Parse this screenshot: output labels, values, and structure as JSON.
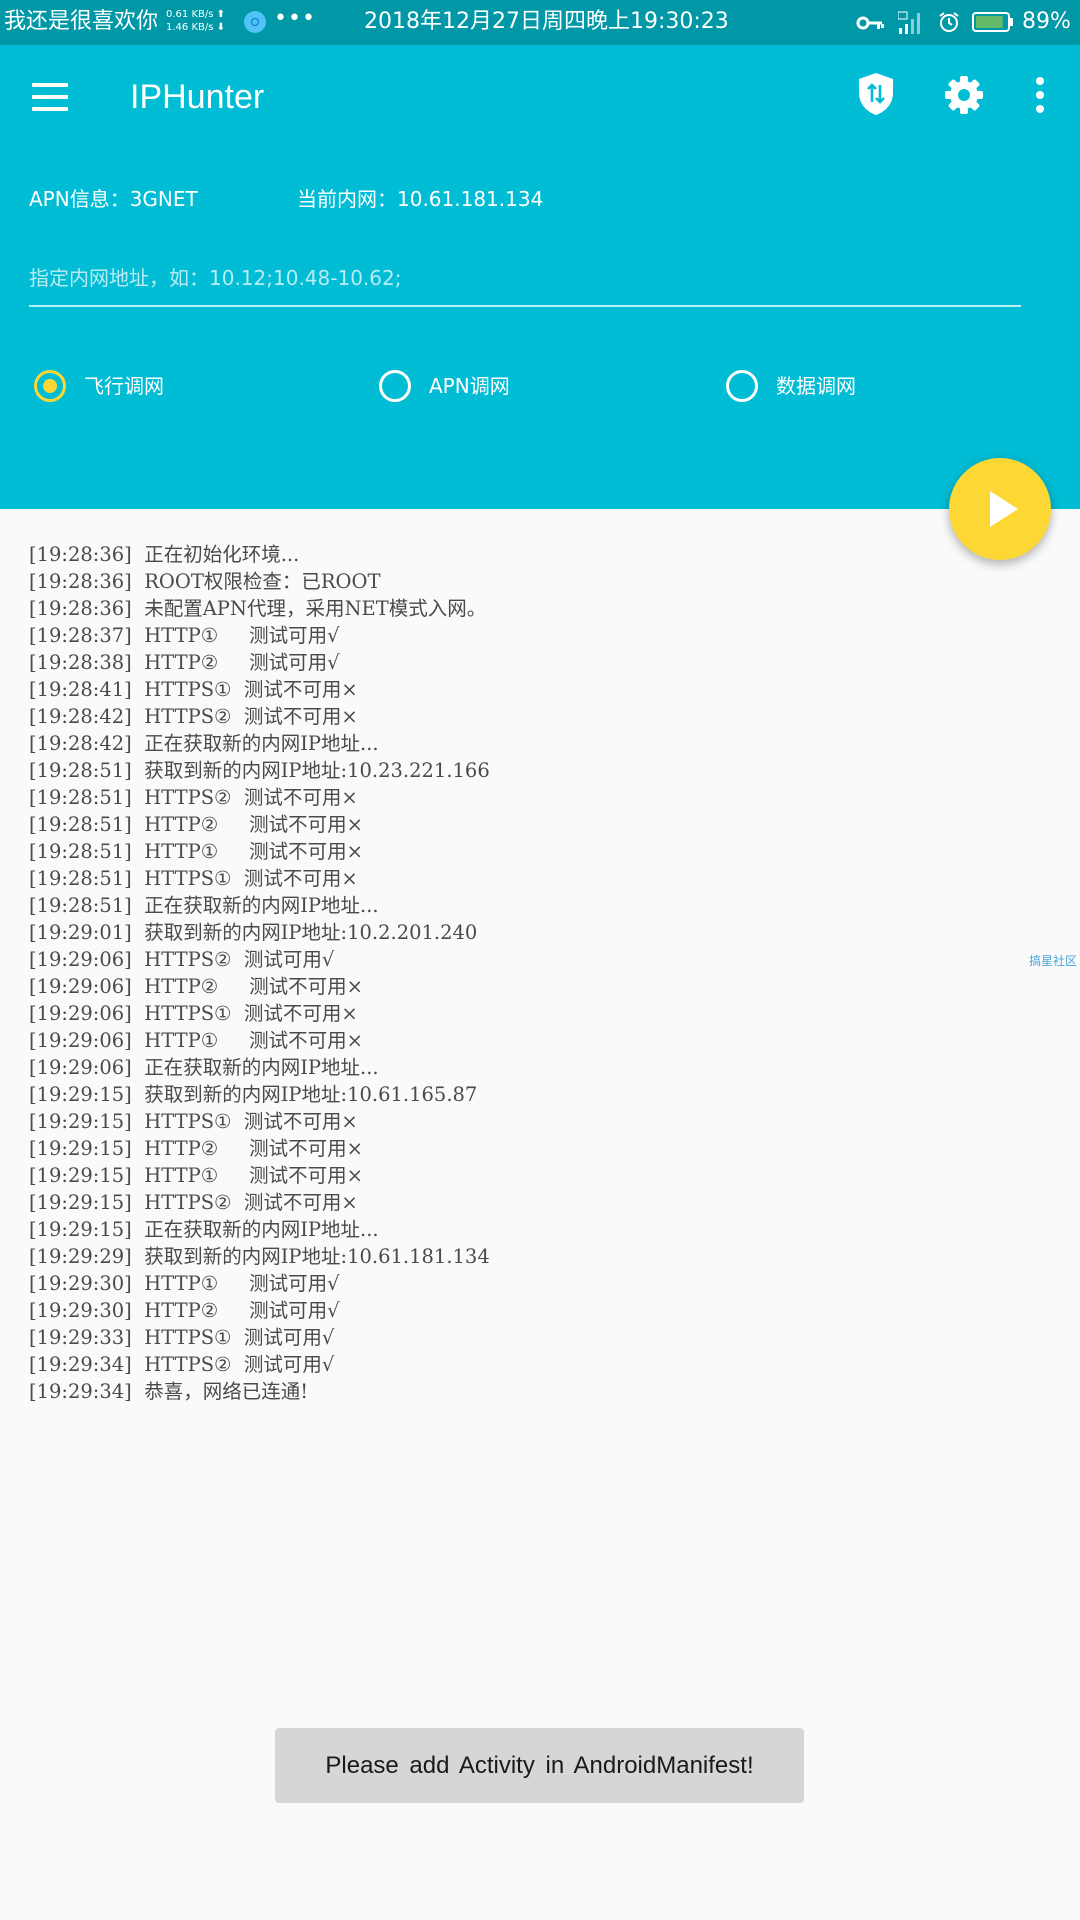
{
  "status_bar": {
    "carrier": "我还是很喜欢你",
    "speed_up": "0.61 KB/s",
    "speed_down": "1.46 KB/s",
    "more": "•••",
    "datetime": "2018年12月27日周四晚上19:30:23",
    "battery_percent": "89%",
    "battery_level": 0.89,
    "icons": [
      "search-icon",
      "key-icon",
      "signal-icon",
      "alarm-icon",
      "battery-icon"
    ]
  },
  "toolbar": {
    "title": "IPHunter",
    "icons": [
      "menu-icon",
      "shield-icon",
      "gear-icon",
      "more-vert-icon"
    ]
  },
  "info": {
    "apn": "APN信息：3GNET",
    "intranet": "当前内网：10.61.181.134"
  },
  "input": {
    "placeholder": "指定内网地址，如：10.12;10.48-10.62;",
    "value": ""
  },
  "modes": [
    {
      "label": "飞行调网",
      "checked": true
    },
    {
      "label": "APN调网",
      "checked": false
    },
    {
      "label": "数据调网",
      "checked": false
    }
  ],
  "fab": {
    "icon": "play-icon"
  },
  "log": [
    "[19:28:36]  正在初始化环境...",
    "[19:28:36]  ROOT权限检查：已ROOT",
    "[19:28:36]  未配置APN代理，采用NET模式入网。",
    "[19:28:37]  HTTP①     测试可用√",
    "[19:28:38]  HTTP②     测试可用√",
    "[19:28:41]  HTTPS①  测试不可用×",
    "[19:28:42]  HTTPS②  测试不可用×",
    "[19:28:42]  正在获取新的内网IP地址...",
    "[19:28:51]  获取到新的内网IP地址:10.23.221.166",
    "[19:28:51]  HTTPS②  测试不可用×",
    "[19:28:51]  HTTP②     测试不可用×",
    "[19:28:51]  HTTP①     测试不可用×",
    "[19:28:51]  HTTPS①  测试不可用×",
    "[19:28:51]  正在获取新的内网IP地址...",
    "[19:29:01]  获取到新的内网IP地址:10.2.201.240",
    "[19:29:06]  HTTPS②  测试可用√",
    "[19:29:06]  HTTP②     测试不可用×",
    "[19:29:06]  HTTPS①  测试不可用×",
    "[19:29:06]  HTTP①     测试不可用×",
    "[19:29:06]  正在获取新的内网IP地址...",
    "[19:29:15]  获取到新的内网IP地址:10.61.165.87",
    "[19:29:15]  HTTPS①  测试不可用×",
    "[19:29:15]  HTTP②     测试不可用×",
    "[19:29:15]  HTTP①     测试不可用×",
    "[19:29:15]  HTTPS②  测试不可用×",
    "[19:29:15]  正在获取新的内网IP地址...",
    "[19:29:29]  获取到新的内网IP地址:10.61.181.134",
    "[19:29:30]  HTTP①     测试可用√",
    "[19:29:30]  HTTP②     测试可用√",
    "[19:29:33]  HTTPS①  测试可用√",
    "[19:29:34]  HTTPS②  测试可用√",
    "[19:29:34]  恭喜，网络已连通!"
  ],
  "watermark": "搞星社区",
  "toast": "Please add Activity in AndroidManifest!",
  "colors": {
    "status_bar": "#0097a7",
    "primary": "#00bcd4",
    "accent": "#fdd835",
    "background": "#fafafa",
    "log_text": "#4a4a4a",
    "toast_bg": "#d6d6d6"
  }
}
